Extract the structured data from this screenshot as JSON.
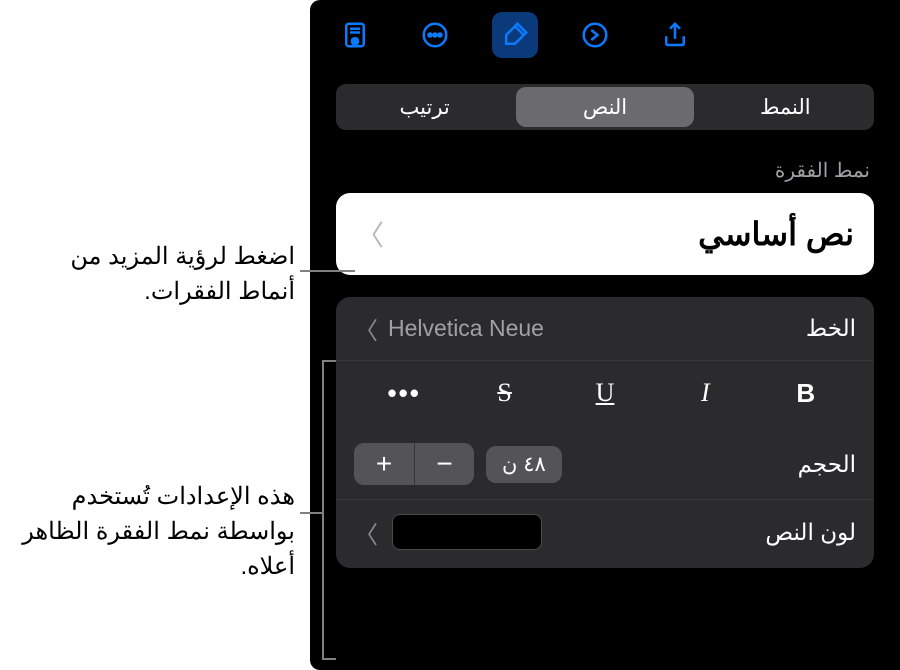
{
  "toolbar": {
    "icons": [
      "share-icon",
      "redo-icon",
      "format-brush-icon",
      "more-icon",
      "document-view-icon"
    ]
  },
  "tabs": {
    "style": "النمط",
    "text": "النص",
    "arrange": "ترتيب"
  },
  "section": {
    "paragraphStyleLabel": "نمط الفقرة"
  },
  "paragraphStyle": {
    "current": "نص أساسي"
  },
  "font": {
    "label": "الخط",
    "value": "Helvetica Neue"
  },
  "styleButtons": {
    "bold": "B",
    "italic": "I",
    "underline": "U",
    "strike": "S",
    "more": "•••"
  },
  "size": {
    "label": "الحجم",
    "value": "٤٨ ن",
    "minus": "−",
    "plus": "+"
  },
  "textColor": {
    "label": "لون النص",
    "value": "#000000"
  },
  "callouts": {
    "c1": "اضغط لرؤية المزيد من أنماط الفقرات.",
    "c2": "هذه الإعدادات تُستخدم بواسطة نمط الفقرة الظاهر أعلاه."
  }
}
